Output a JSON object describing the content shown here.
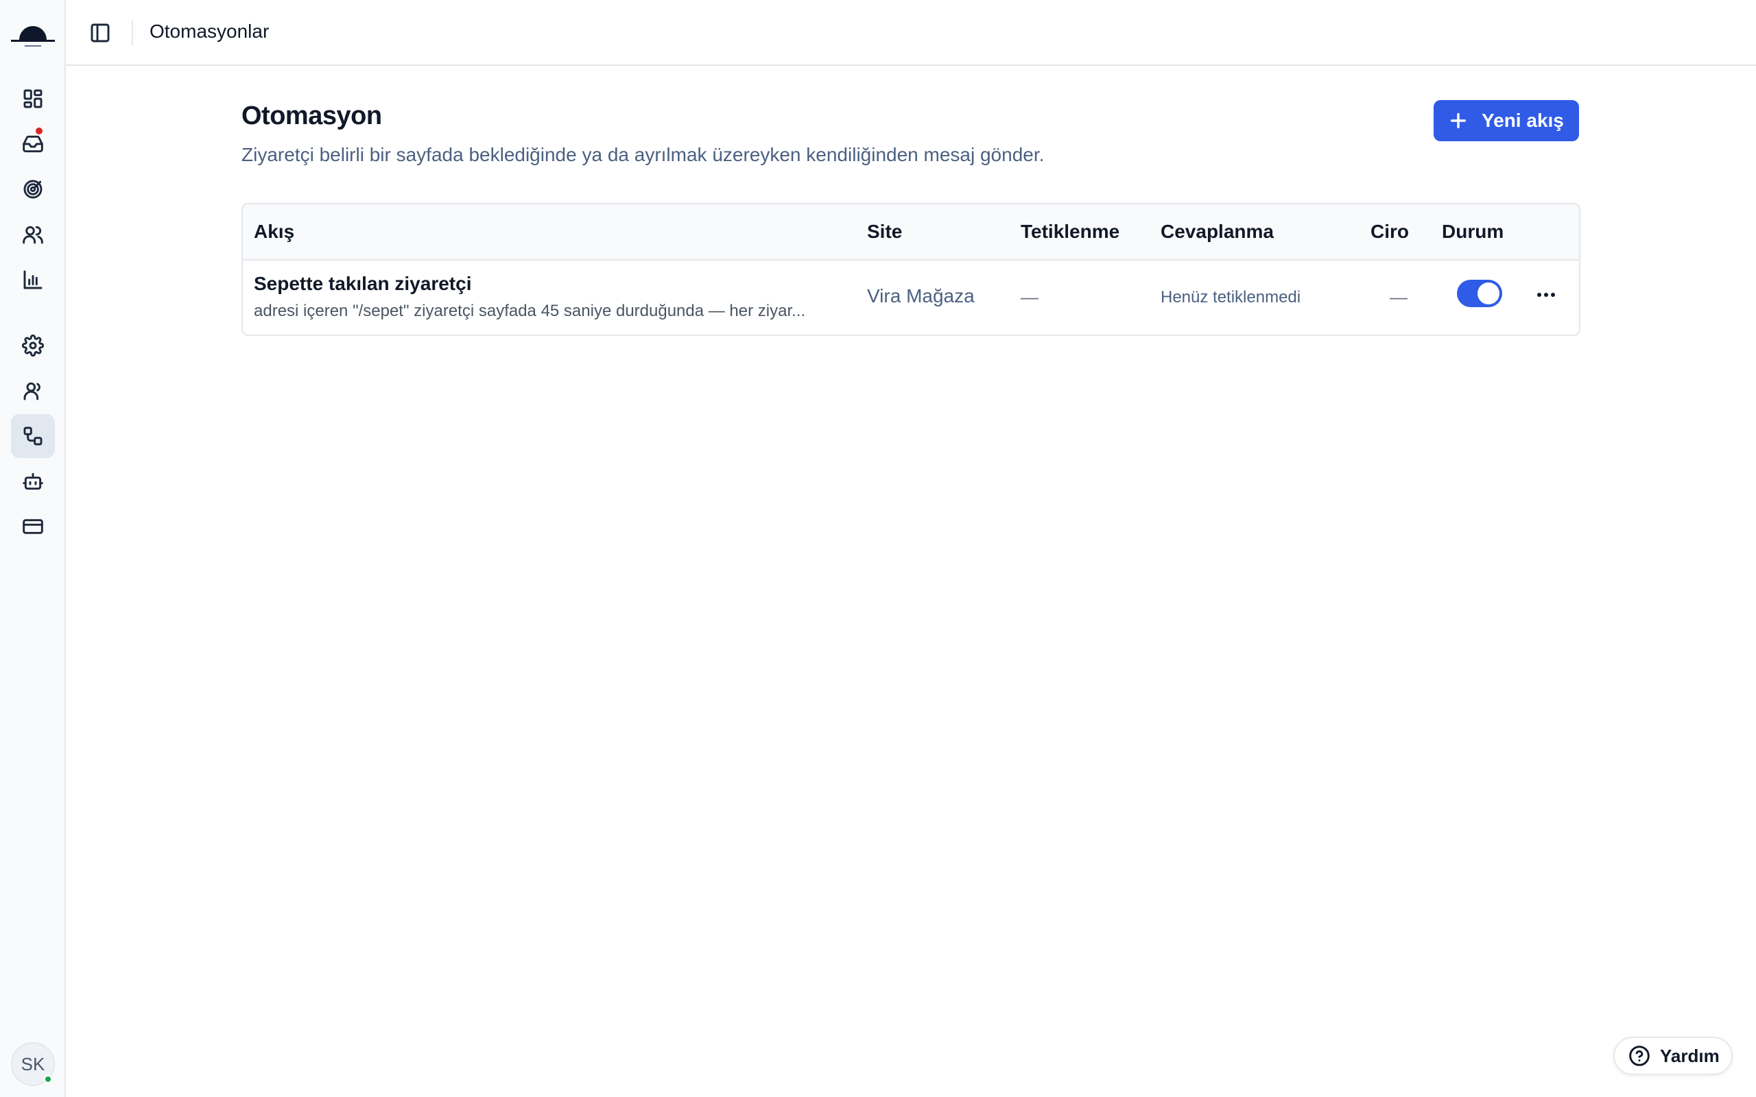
{
  "topbar": {
    "title": "Otomasyonlar"
  },
  "page": {
    "title": "Otomasyon",
    "subtitle": "Ziyaretçi belirli bir sayfada beklediğinde ya da ayrılmak üzereyken kendiliğinden mesaj gönder.",
    "new_button_label": "Yeni akış"
  },
  "table": {
    "headers": {
      "flow": "Akış",
      "site": "Site",
      "triggers": "Tetiklenme",
      "responses": "Cevaplanma",
      "revenue": "Ciro",
      "status": "Durum"
    },
    "rows": [
      {
        "name": "Sepette takılan ziyaretçi",
        "description": "adresi içeren \"/sepet\" ziyaretçi sayfada 45 saniye durduğunda — her ziyar...",
        "site": "Vira Mağaza",
        "triggers": "—",
        "responses": "Henüz tetiklenmedi",
        "revenue": "—",
        "enabled": true
      }
    ]
  },
  "user": {
    "initials": "SK",
    "online": true
  },
  "help": {
    "label": "Yardım"
  },
  "colors": {
    "accent": "#2f5be6",
    "notification": "#dc2626",
    "online": "#16a34a"
  },
  "sidebar": {
    "icons": [
      "dashboard-icon",
      "inbox-icon",
      "target-icon",
      "users-icon",
      "chart-icon",
      "settings-icon",
      "team-icon",
      "automation-icon",
      "bot-icon",
      "billing-icon"
    ],
    "active": "automation-icon",
    "inbox_has_notification": true
  }
}
